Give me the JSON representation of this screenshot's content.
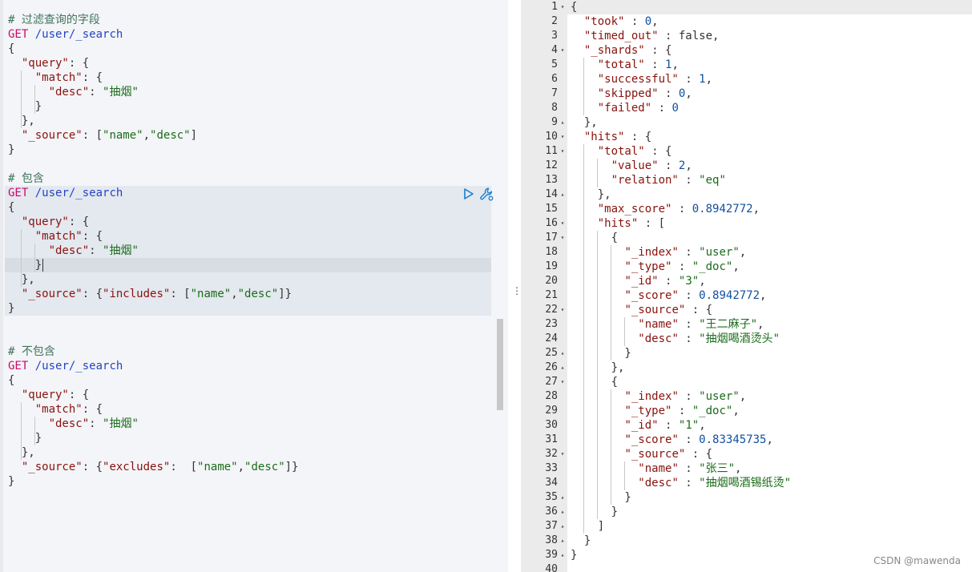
{
  "request_editor": {
    "blocks": [
      {
        "comment": "# 过滤查询的字段",
        "method": "GET",
        "path": "/user/_search",
        "body": [
          "{",
          "  \"query\": {",
          "    \"match\": {",
          "      \"desc\": \"抽烟\"",
          "    }",
          "  },",
          "  \"_source\": [\"name\",\"desc\"]",
          "}"
        ]
      },
      {
        "comment": "# 包含",
        "method": "GET",
        "path": "/user/_search",
        "body": [
          "{",
          "  \"query\": {",
          "    \"match\": {",
          "      \"desc\": \"抽烟\"",
          "    }",
          "  },",
          "  \"_source\": {\"includes\": [\"name\",\"desc\"]}",
          "}"
        ]
      },
      {
        "comment": "# 不包含",
        "method": "GET",
        "path": "/user/_search",
        "body": [
          "{",
          "  \"query\": {",
          "    \"match\": {",
          "      \"desc\": \"抽烟\"",
          "    }",
          "  },",
          "  \"_source\": {\"excludes\":  [\"name\",\"desc\"]}",
          "}"
        ]
      }
    ],
    "run_icon": "play-icon",
    "settings_icon": "wrench-icon"
  },
  "response_viewer": {
    "lines": [
      "{",
      "  \"took\" : 0,",
      "  \"timed_out\" : false,",
      "  \"_shards\" : {",
      "    \"total\" : 1,",
      "    \"successful\" : 1,",
      "    \"skipped\" : 0,",
      "    \"failed\" : 0",
      "  },",
      "  \"hits\" : {",
      "    \"total\" : {",
      "      \"value\" : 2,",
      "      \"relation\" : \"eq\"",
      "    },",
      "    \"max_score\" : 0.8942772,",
      "    \"hits\" : [",
      "      {",
      "        \"_index\" : \"user\",",
      "        \"_type\" : \"_doc\",",
      "        \"_id\" : \"3\",",
      "        \"_score\" : 0.8942772,",
      "        \"_source\" : {",
      "          \"name\" : \"王二麻子\",",
      "          \"desc\" : \"抽烟喝酒烫头\"",
      "        }",
      "      },",
      "      {",
      "        \"_index\" : \"user\",",
      "        \"_type\" : \"_doc\",",
      "        \"_id\" : \"1\",",
      "        \"_score\" : 0.83345735,",
      "        \"_source\" : {",
      "          \"name\" : \"张三\",",
      "          \"desc\" : \"抽烟喝酒锡纸烫\"",
      "        }",
      "      }",
      "    ]",
      "  }",
      "}",
      ""
    ],
    "fold_open_lines": [
      1,
      4,
      10,
      11,
      16,
      17,
      22,
      27,
      32
    ],
    "fold_close_lines": [
      9,
      14,
      25,
      26,
      35,
      36,
      37,
      38,
      39
    ],
    "fold_open_glyph": "▾",
    "fold_close_glyph": "▴"
  },
  "splitter_glyph": "⋮",
  "watermark": "CSDN @mawenda"
}
